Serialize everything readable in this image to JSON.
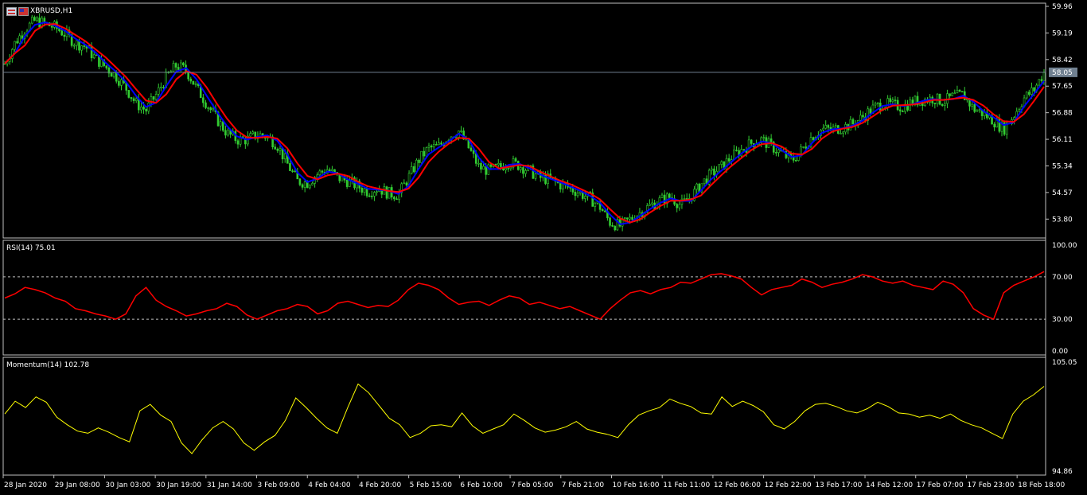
{
  "header": {
    "symbol_label": "XBRUSD,H1"
  },
  "icons": [
    "uk-flag-icon",
    "us-flag-icon"
  ],
  "colors": {
    "background": "#000000",
    "candle": "#32cd32",
    "ma_fast": "#0000ff",
    "ma_slow": "#ff0000",
    "rsi_line": "#ff0000",
    "momentum_line": "#ffff00",
    "grid_border": "#c0c0c0",
    "current_price_line": "#708090"
  },
  "chart_data": [
    {
      "type": "line",
      "title": "XBRUSD,H1",
      "y_ticks": [
        "59.96",
        "59.19",
        "58.42",
        "57.65",
        "56.88",
        "56.11",
        "55.34",
        "54.57",
        "53.80"
      ],
      "ylim": [
        53.3,
        59.96
      ],
      "current_price": "58.05",
      "x_ticks": [
        "28 Jan 2020",
        "29 Jan 08:00",
        "30 Jan 03:00",
        "30 Jan 19:00",
        "31 Jan 14:00",
        "3 Feb 09:00",
        "4 Feb 04:00",
        "4 Feb 20:00",
        "5 Feb 15:00",
        "6 Feb 10:00",
        "7 Feb 05:00",
        "7 Feb 21:00",
        "10 Feb 16:00",
        "11 Feb 11:00",
        "12 Feb 06:00",
        "12 Feb 22:00",
        "13 Feb 17:00",
        "14 Feb 12:00",
        "17 Feb 07:00",
        "17 Feb 23:00",
        "18 Feb 18:00"
      ],
      "series": [
        {
          "values": [
            58.3,
            58.9,
            59.3,
            59.55,
            59.45,
            59.35,
            59.15,
            58.9,
            58.8,
            58.45,
            58.2,
            57.95,
            57.6,
            57.15,
            56.95,
            57.4,
            57.9,
            58.25,
            58.1,
            57.6,
            57.15,
            56.7,
            56.3,
            56.1,
            56.1,
            56.25,
            56.2,
            55.95,
            55.4,
            54.9,
            54.85,
            55.1,
            55.25,
            55.0,
            54.9,
            54.75,
            54.6,
            54.7,
            54.55,
            54.5,
            55.0,
            55.5,
            55.85,
            55.9,
            56.2,
            56.35,
            55.85,
            55.3,
            55.2,
            55.3,
            55.45,
            55.35,
            55.2,
            55.0,
            54.95,
            54.8,
            54.7,
            54.55,
            54.4,
            54.15,
            53.7,
            53.6,
            53.8,
            54.0,
            54.2,
            54.35,
            54.45,
            54.2,
            54.45,
            54.8,
            55.1,
            55.3,
            55.6,
            55.8,
            56.0,
            56.1,
            55.9,
            55.7,
            55.5,
            55.8,
            56.2,
            56.4,
            56.4,
            56.45,
            56.55,
            56.75,
            57.0,
            57.15,
            57.1,
            57.05,
            57.2,
            57.25,
            57.3,
            57.2,
            57.35,
            57.4,
            57.0,
            56.85,
            56.65,
            56.4,
            56.8,
            57.3,
            57.55,
            58.05
          ]
        }
      ]
    },
    {
      "type": "line",
      "title": "RSI(14) 75.01",
      "y_ticks": [
        "100.00",
        "70.00",
        "30.00",
        "0.00"
      ],
      "ylim": [
        0,
        100
      ],
      "levels": [
        70,
        30
      ],
      "series": [
        {
          "values": [
            50,
            54,
            60,
            58,
            55,
            50,
            47,
            40,
            38,
            35,
            33,
            30,
            35,
            52,
            60,
            48,
            42,
            38,
            33,
            35,
            38,
            40,
            45,
            42,
            34,
            30,
            34,
            38,
            40,
            44,
            42,
            35,
            38,
            45,
            47,
            44,
            41,
            43,
            42,
            48,
            58,
            64,
            62,
            58,
            50,
            44,
            46,
            47,
            43,
            48,
            52,
            50,
            44,
            46,
            43,
            40,
            42,
            38,
            34,
            30,
            40,
            48,
            55,
            57,
            54,
            58,
            60,
            65,
            64,
            68,
            72,
            73,
            71,
            68,
            60,
            53,
            58,
            60,
            62,
            68,
            65,
            60,
            63,
            65,
            68,
            72,
            70,
            66,
            64,
            66,
            62,
            60,
            58,
            66,
            63,
            55,
            40,
            34,
            30,
            55,
            62,
            66,
            70,
            75
          ]
        }
      ]
    },
    {
      "type": "line",
      "title": "Momentum(14) 102.78",
      "y_ticks": [
        "105.05",
        "94.86"
      ],
      "ylim": [
        94.86,
        105.05
      ],
      "series": [
        {
          "values": [
            100.2,
            101.4,
            100.8,
            101.8,
            101.3,
            99.9,
            99.2,
            98.6,
            98.4,
            98.9,
            98.5,
            98.0,
            97.6,
            100.5,
            101.1,
            100.1,
            99.5,
            97.5,
            96.5,
            97.8,
            98.9,
            99.5,
            98.8,
            97.5,
            96.8,
            97.6,
            98.2,
            99.6,
            101.7,
            100.8,
            99.8,
            98.9,
            98.4,
            100.8,
            103.0,
            102.2,
            101.0,
            99.8,
            99.2,
            98.0,
            98.4,
            99.1,
            99.2,
            99.0,
            100.3,
            99.1,
            98.4,
            98.8,
            99.2,
            100.2,
            99.6,
            98.9,
            98.5,
            98.7,
            99.0,
            99.5,
            98.8,
            98.5,
            98.3,
            98.0,
            99.2,
            100.1,
            100.5,
            100.8,
            101.6,
            101.2,
            100.9,
            100.3,
            100.2,
            101.8,
            100.9,
            101.4,
            101.0,
            100.4,
            99.2,
            98.8,
            99.5,
            100.5,
            101.1,
            101.2,
            100.9,
            100.5,
            100.3,
            100.7,
            101.3,
            100.9,
            100.3,
            100.2,
            99.9,
            100.1,
            99.8,
            100.2,
            99.6,
            99.2,
            98.9,
            98.4,
            97.9,
            100.2,
            101.4,
            102.0,
            102.78
          ]
        }
      ]
    }
  ]
}
